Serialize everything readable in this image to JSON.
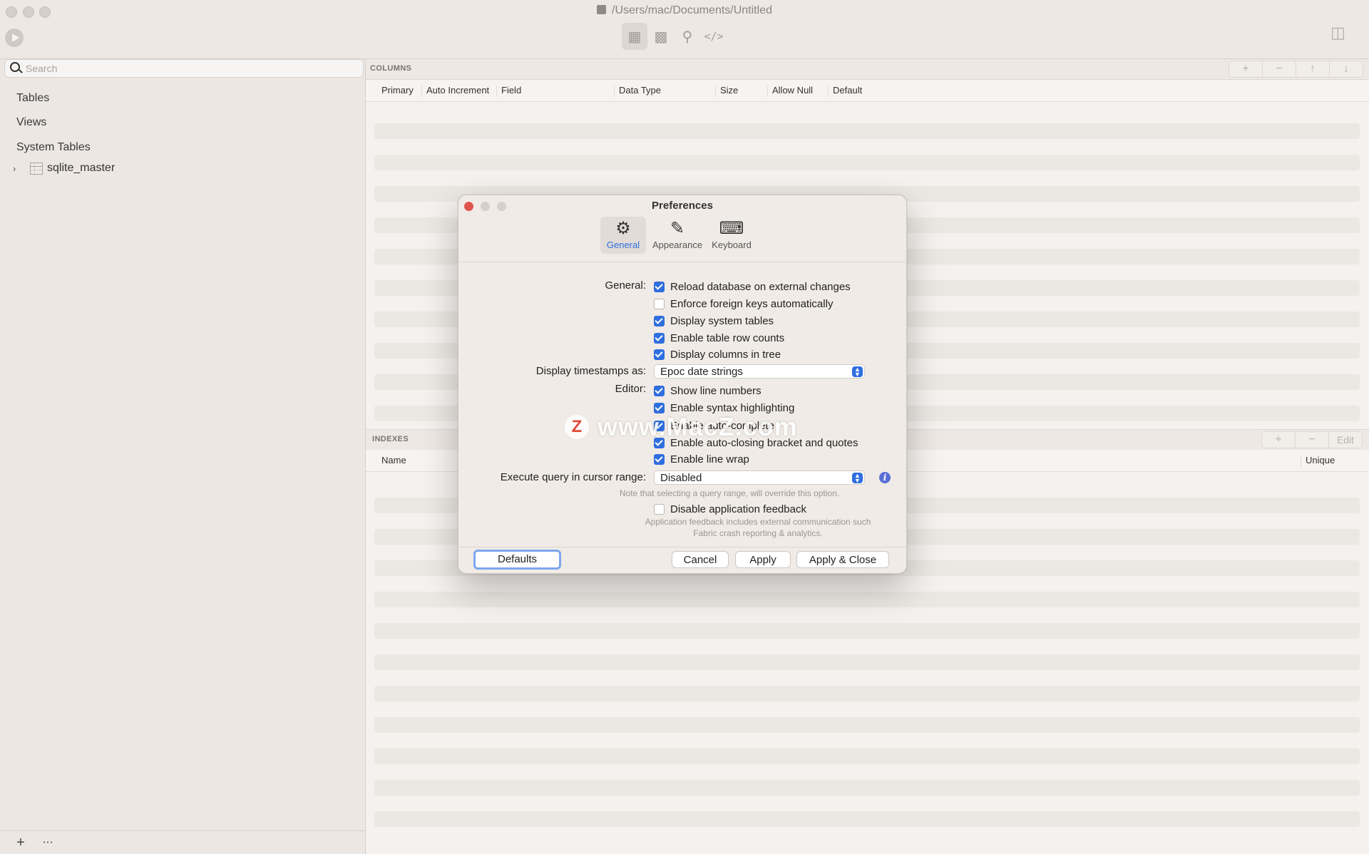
{
  "window": {
    "title": "/Users/mac/Documents/Untitled"
  },
  "sidebar": {
    "search_placeholder": "Search",
    "sections": [
      "Tables",
      "Views",
      "System Tables"
    ],
    "tree": [
      {
        "label": "sqlite_master"
      }
    ]
  },
  "columns": {
    "title": "COLUMNS",
    "headers": [
      "Primary",
      "Auto Increment",
      "Field",
      "Data Type",
      "Size",
      "Allow Null",
      "Default"
    ]
  },
  "indexes": {
    "title": "INDEXES",
    "headers": [
      "Name",
      "Unique"
    ],
    "edit_label": "Edit"
  },
  "preferences": {
    "title": "Preferences",
    "tabs": [
      "General",
      "Appearance",
      "Keyboard"
    ],
    "general_label": "General:",
    "general_options": [
      {
        "label": "Reload database on external changes",
        "checked": true
      },
      {
        "label": "Enforce foreign keys automatically",
        "checked": false
      },
      {
        "label": "Display system tables",
        "checked": true
      },
      {
        "label": "Enable table row counts",
        "checked": true
      },
      {
        "label": "Display columns in tree",
        "checked": true
      }
    ],
    "timestamps_label": "Display timestamps as:",
    "timestamps_value": "Epoc date strings",
    "editor_label": "Editor:",
    "editor_options": [
      {
        "label": "Show line numbers",
        "checked": true
      },
      {
        "label": "Enable syntax highlighting",
        "checked": true
      },
      {
        "label": "Enable auto-complete",
        "checked": true
      },
      {
        "label": "Enable auto-closing bracket and quotes",
        "checked": true
      },
      {
        "label": "Enable line wrap",
        "checked": true
      }
    ],
    "cursor_range_label": "Execute query in cursor range:",
    "cursor_range_value": "Disabled",
    "cursor_range_note": "Note that selecting a query range, will override this option.",
    "feedback_option": {
      "label": "Disable application feedback",
      "checked": false
    },
    "feedback_note_1": "Application feedback includes external communication such",
    "feedback_note_2": "Fabric crash reporting & analytics.",
    "buttons": {
      "defaults": "Defaults",
      "cancel": "Cancel",
      "apply": "Apply",
      "apply_close": "Apply & Close"
    }
  },
  "watermark": {
    "logo": "Z",
    "text": "www.MacZ.com"
  },
  "colors": {
    "accent": "#2f6ede",
    "close": "#e0554b"
  }
}
